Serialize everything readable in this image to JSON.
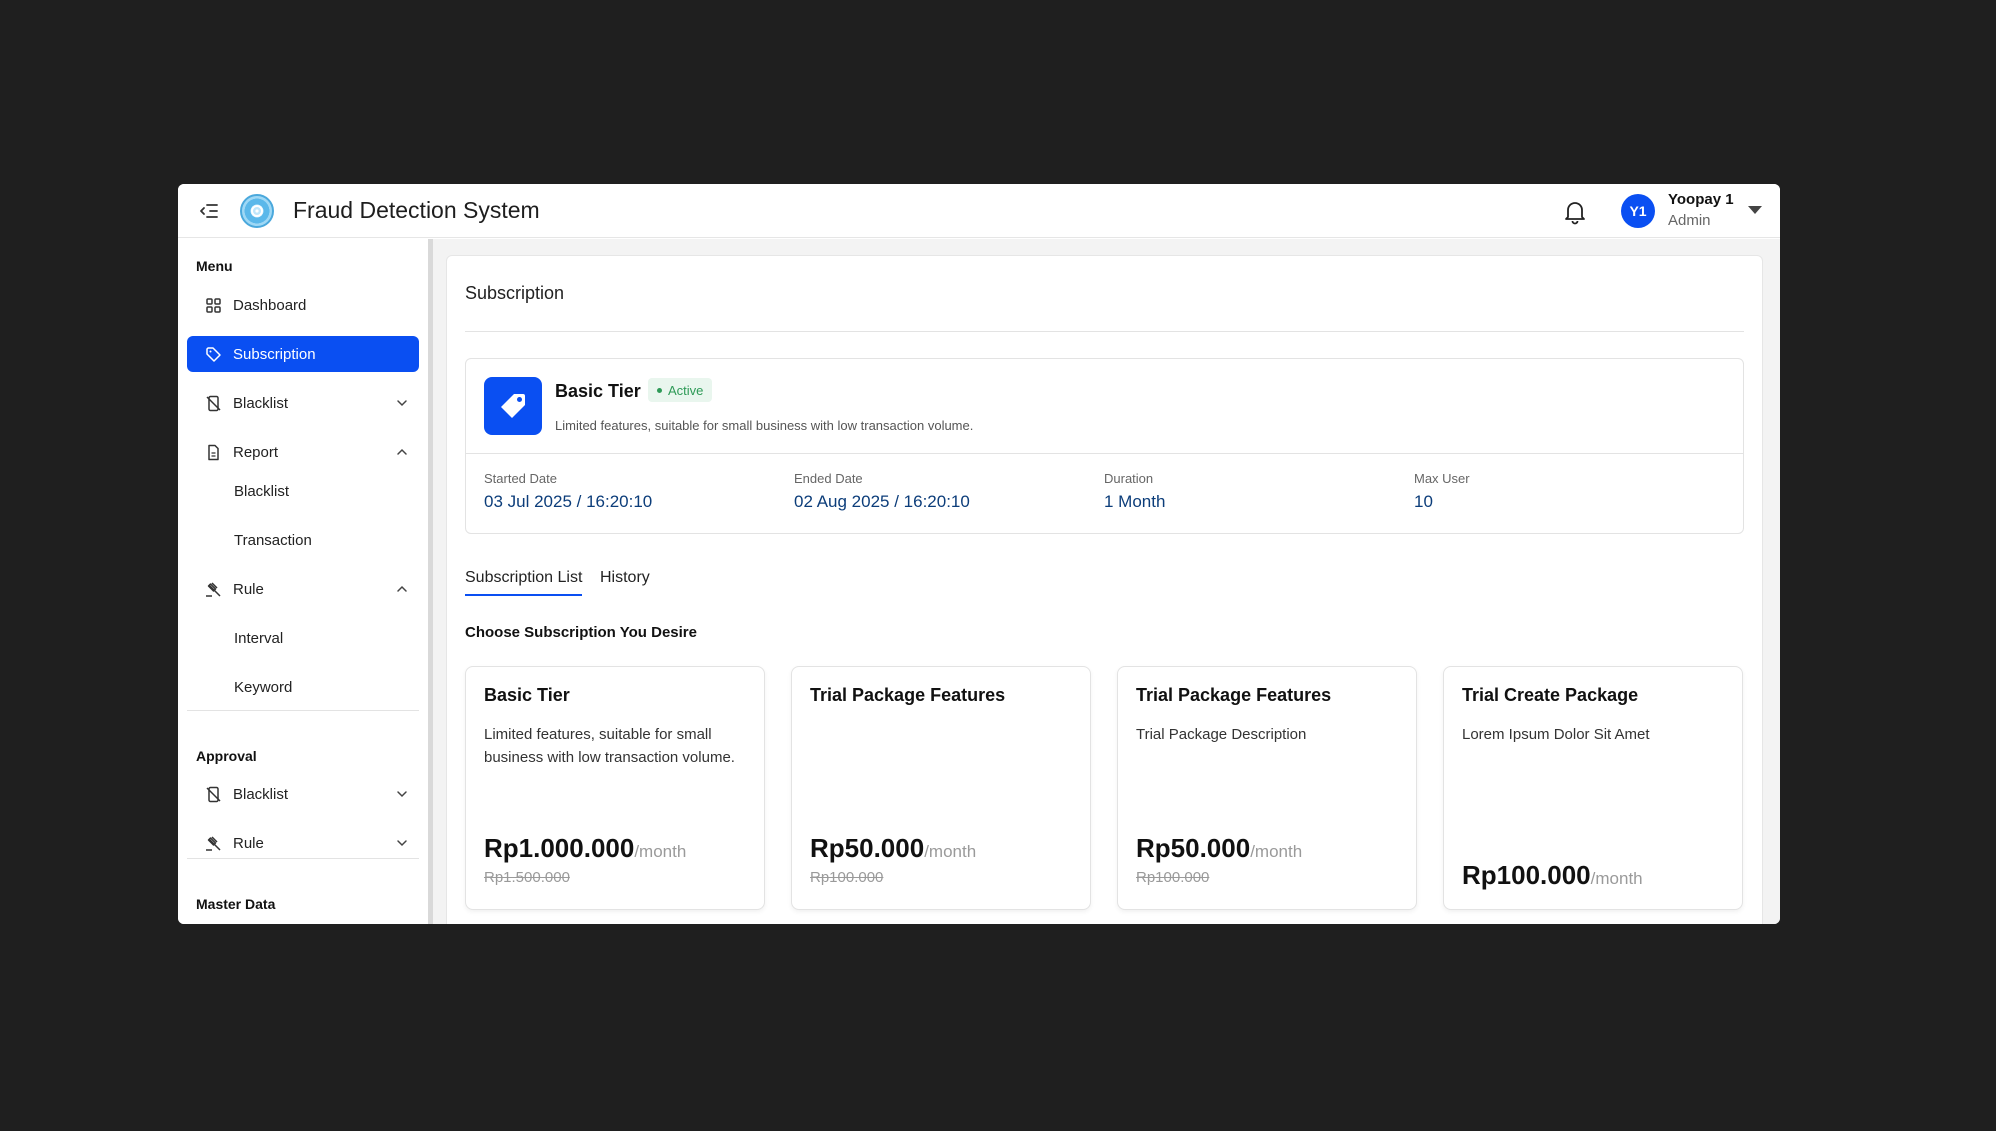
{
  "header": {
    "title": "Fraud Detection System",
    "user_initials": "Y1",
    "user_name": "Yoopay 1",
    "user_role": "Admin"
  },
  "sidebar": {
    "menu_title": "Menu",
    "items": [
      {
        "label": "Dashboard",
        "icon": "grid-icon"
      },
      {
        "label": "Subscription",
        "icon": "tag-icon",
        "active": true
      },
      {
        "label": "Blacklist",
        "icon": "blocked-phone-icon"
      },
      {
        "label": "Report",
        "icon": "document-icon"
      },
      {
        "label": "Rule",
        "icon": "gavel-icon"
      }
    ],
    "report_sub": [
      "Blacklist",
      "Transaction"
    ],
    "rule_sub": [
      "Interval",
      "Keyword"
    ],
    "approval_title": "Approval",
    "approval_items": [
      {
        "label": "Blacklist",
        "icon": "blocked-phone-icon"
      },
      {
        "label": "Rule",
        "icon": "gavel-icon"
      }
    ],
    "master_title": "Master Data"
  },
  "main": {
    "title": "Subscription",
    "current": {
      "name": "Basic Tier",
      "status": "Active",
      "description": "Limited features, suitable for small business with low transaction volume.",
      "started_label": "Started Date",
      "started_value": "03 Jul 2025 / 16:20:10",
      "ended_label": "Ended Date",
      "ended_value": "02 Aug 2025 / 16:20:10",
      "duration_label": "Duration",
      "duration_value": "1 Month",
      "max_user_label": "Max User",
      "max_user_value": "10"
    },
    "tabs": [
      {
        "label": "Subscription List",
        "active": true
      },
      {
        "label": "History",
        "active": false
      }
    ],
    "choose_title": "Choose Subscription You Desire",
    "plans": [
      {
        "name": "Basic Tier",
        "description": "Limited features, suitable for small business with low transaction volume.",
        "price": "Rp1.000.000",
        "per": "/month",
        "old_price": "Rp1.500.000"
      },
      {
        "name": "Trial Package Features",
        "description": "",
        "price": "Rp50.000",
        "per": "/month",
        "old_price": "Rp100.000"
      },
      {
        "name": "Trial Package Features",
        "description": "Trial Package Description",
        "price": "Rp50.000",
        "per": "/month",
        "old_price": "Rp100.000"
      },
      {
        "name": "Trial Create Package",
        "description": "Lorem Ipsum Dolor Sit Amet",
        "price": "Rp100.000",
        "per": "/month",
        "old_price": ""
      }
    ]
  },
  "colors": {
    "accent": "#0a4ff2",
    "active_badge_bg": "#e9f6ee",
    "active_badge_text": "#2e9a57",
    "meta_value": "#0c3d7a"
  }
}
